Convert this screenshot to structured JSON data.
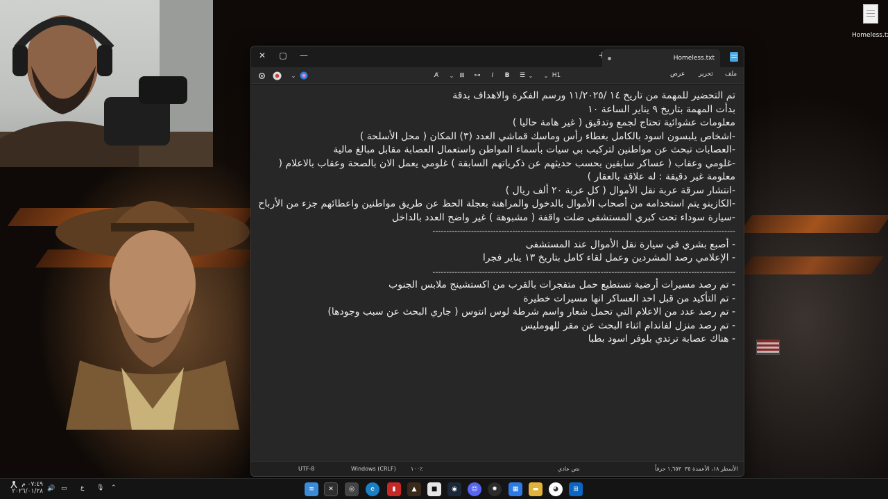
{
  "desktop": {
    "file_icon_label": "Homeless.txt"
  },
  "window": {
    "tab_name": "Homeless.txt",
    "new_tab": "+",
    "close_glyph": "✕",
    "maximize_glyph": "▢",
    "minimize_glyph": "—",
    "menu": {
      "file": "ملف",
      "edit": "تحرير",
      "view": "عرض"
    },
    "heading_label": "H1"
  },
  "document": {
    "lines": [
      "تم التحضير للمهمة من تاريخ ١٤ /١١/٢٠٢٥ ورسم الفكرة والاهداف بدقة",
      "بدأت المهمة بتاريخ ٩ يناير الساعة ١٠",
      "معلومات عشوائية تحتاج لجمع وتدقيق ( غير هامة حاليا )",
      "-اشخاص يلبسون اسود بالكامل بغطاء رأس وماسك قماشي العدد (٣) المكان ( محل الأسلحة )",
      "-العصابات تبحث عن مواطنين لتركيب بي سيات بأسماء المواطن واستعمال العصابة مقابل مبالغ مالية",
      "-غلومي وعقاب ( عساكر سابقين بحسب حديثهم عن ذكرياتهم السابقة ) غلومي يعمل الان بالصحة وعقاب بالاعلام ( معلومة غير دقيقة : له علاقة بالعقار )",
      "-انتشار سرقة عربة نقل الأموال ( كل عربة ٢٠ ألف ريال )",
      "-الكازينو يتم استخدامه من أصحاب الأموال بالدخول والمراهنة بعجلة الحظ عن طريق مواطنين واعطائهم جزء من الأرباح",
      "-سيارة سوداء تحت كبري المستشفى ضلت واقفة ( مشبوهة ) غير واضح العدد بالداخل",
      "--------------------------------------------------------------------------------------------------------------",
      "- أصبع بشري في سيارة نقل الأموال عند المستشفى",
      "- الإعلامي رصد المشردين وعمل لقاء كامل بتاريخ ١٣ يناير فجرا",
      "--------------------------------------------------------------------------------------------------------------",
      "- تم رصد مسيرات أرضية تستطيع حمل متفجرات بالقرب من اكستشينج ملابس الجنوب",
      "- تم التأكيد من قبل احد العساكر انها مسيرات خطيرة",
      "- تم رصد عدد من الاعلام التي تحمل شعار واسم شرطة لوس انتوس ( جاري البحث عن سبب وجودها)",
      "- تم رصد منزل لفاندام اثناء البحث عن مقر للهومليس",
      "- هناك عصابة ترتدي بلوفر اسود بطبا"
    ]
  },
  "status": {
    "position": "الأسطر ١٨، الأعمدة ٣٥",
    "chars": "١,٦٥٣ حرفاً",
    "format": "نص عادي",
    "zoom": "١٠٠٪",
    "line_ending": "Windows (CRLF)",
    "encoding": "UTF-8"
  },
  "tray": {
    "time": "٠٧:٤٩ م",
    "date": "٢٠٢٦/٠١/٢٨",
    "language": "ع"
  },
  "colors": {
    "accent": "#4ca4e0",
    "editor_bg": "#272727",
    "text": "#ececec"
  }
}
